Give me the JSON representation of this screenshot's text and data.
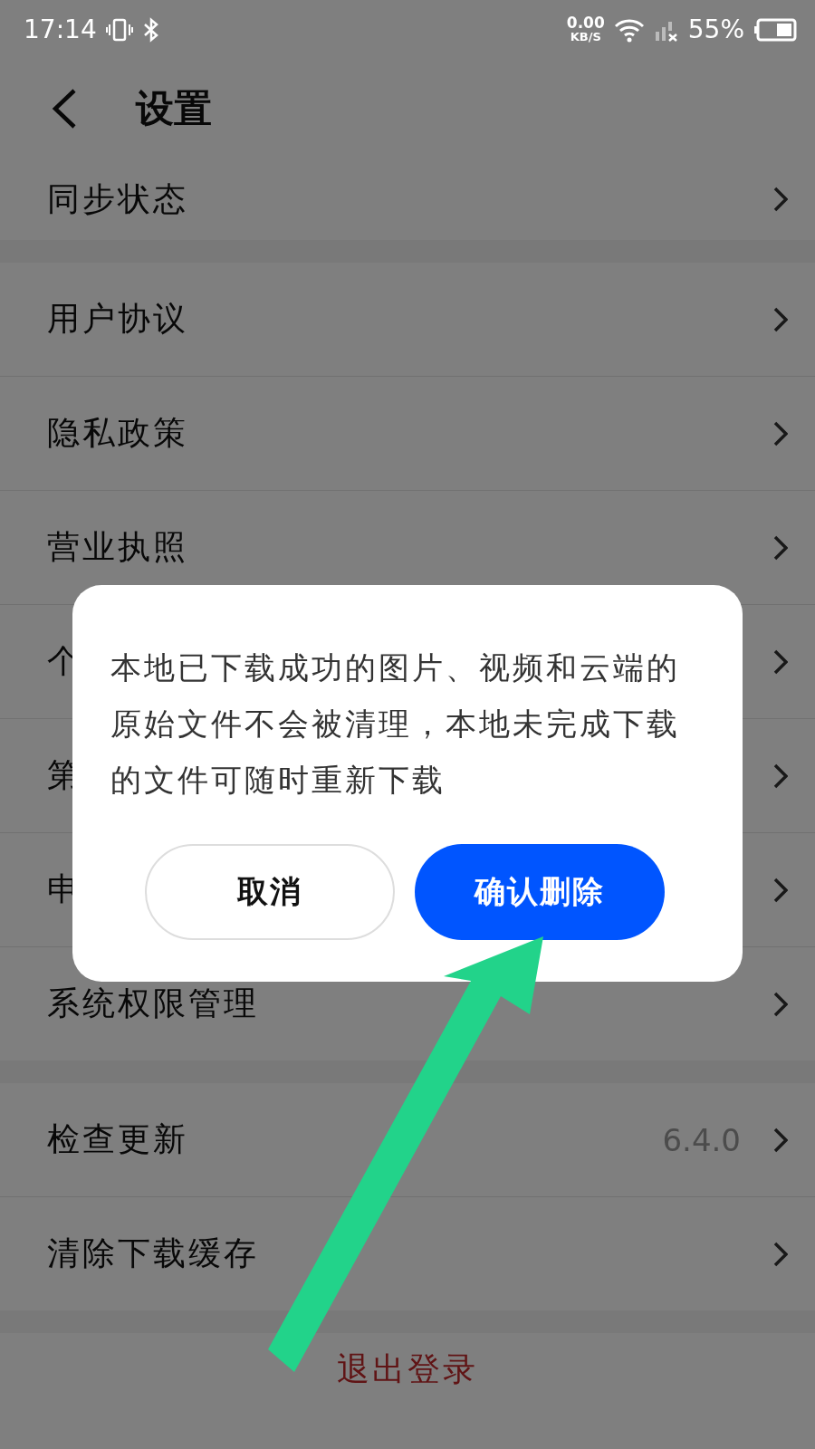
{
  "status_bar": {
    "time": "17:14",
    "net_speed": "0.00",
    "net_unit": "KB/S",
    "battery": "55%"
  },
  "header": {
    "title": "设置"
  },
  "groups": [
    [
      {
        "label": "同步状态"
      }
    ],
    [
      {
        "label": "用户协议"
      },
      {
        "label": "隐私政策"
      },
      {
        "label": "营业执照"
      },
      {
        "label": "个"
      },
      {
        "label": "第"
      },
      {
        "label": "申"
      },
      {
        "label": "系统权限管理"
      }
    ],
    [
      {
        "label": "检查更新",
        "value": "6.4.0"
      },
      {
        "label": "清除下载缓存"
      }
    ]
  ],
  "logout": "退出登录",
  "dialog": {
    "message": "本地已下载成功的图片、视频和云端的原始文件不会被清理，本地未完成下载的文件可随时重新下载",
    "buttons": [
      {
        "label": "取消",
        "kind": "secondary"
      },
      {
        "label": "确认删除",
        "kind": "primary"
      }
    ]
  }
}
